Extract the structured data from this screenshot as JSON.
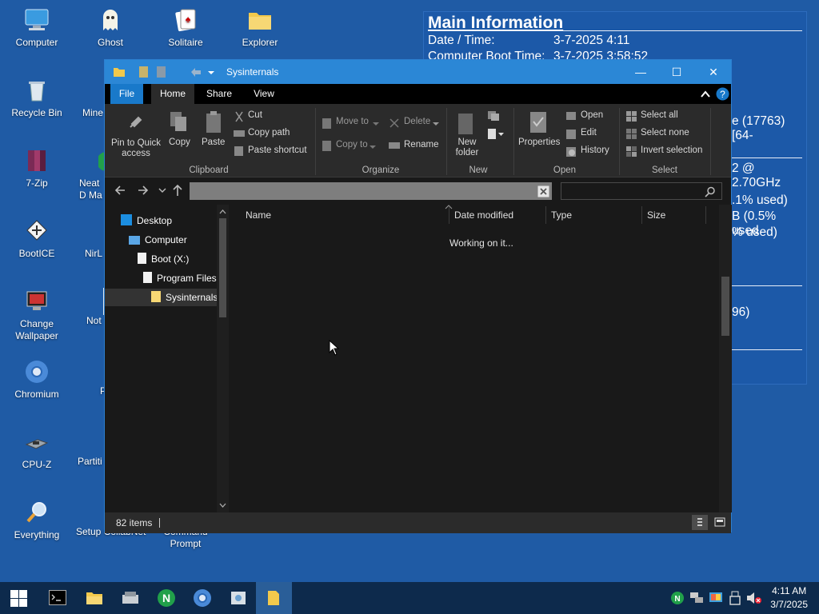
{
  "desktop": {
    "icons": [
      {
        "label": "Computer"
      },
      {
        "label": "Ghost"
      },
      {
        "label": "Solitaire"
      },
      {
        "label": "Explorer"
      },
      {
        "label": "Recycle Bin"
      },
      {
        "label": "Mine"
      },
      {
        "label": "7-Zip"
      },
      {
        "label": "Neat D Ma"
      },
      {
        "label": "BootICE"
      },
      {
        "label": "NirL"
      },
      {
        "label": "Change Wallpaper"
      },
      {
        "label": "Not"
      },
      {
        "label": "Chromium"
      },
      {
        "label": "P"
      },
      {
        "label": "CPU-Z"
      },
      {
        "label": "Partiti"
      },
      {
        "label": "Everything"
      },
      {
        "label": "Setup CollabNet"
      },
      {
        "label": "Command Prompt"
      }
    ]
  },
  "info": {
    "title": "Main Information",
    "rows": [
      {
        "label": "Date / Time:",
        "value": "3-7-2025 4:11"
      },
      {
        "label": "Computer Boot Time:",
        "value": "3-7-2025 3:58:52"
      }
    ],
    "fragments": [
      "e (17763) [64-",
      "2 @ 2.70GHz",
      ".1% used)",
      "B (0.5% used",
      "% used)",
      "96)"
    ]
  },
  "window": {
    "title": "Sysinternals",
    "tabs": {
      "file": "File",
      "home": "Home",
      "share": "Share",
      "view": "View"
    },
    "ribbon": {
      "pin": "Pin to Quick access",
      "copy": "Copy",
      "paste": "Paste",
      "cut": "Cut",
      "copy_path": "Copy path",
      "paste_shortcut": "Paste shortcut",
      "move_to": "Move to",
      "copy_to": "Copy to",
      "delete": "Delete",
      "rename": "Rename",
      "new_folder": "New folder",
      "properties": "Properties",
      "open": "Open",
      "edit": "Edit",
      "history": "History",
      "select_all": "Select all",
      "select_none": "Select none",
      "invert_selection": "Invert selection",
      "groups": {
        "clipboard": "Clipboard",
        "organize": "Organize",
        "new": "New",
        "open": "Open",
        "select": "Select"
      }
    },
    "nav": {
      "items": [
        {
          "label": "Desktop"
        },
        {
          "label": "Computer"
        },
        {
          "label": "Boot (X:)"
        },
        {
          "label": "Program Files"
        },
        {
          "label": "Sysinternals"
        }
      ]
    },
    "columns": {
      "name": "Name",
      "date": "Date modified",
      "type": "Type",
      "size": "Size"
    },
    "working": "Working on it...",
    "status": {
      "items": "82 items"
    }
  },
  "taskbar": {
    "time": "4:11 AM",
    "date": "3/7/2025"
  }
}
